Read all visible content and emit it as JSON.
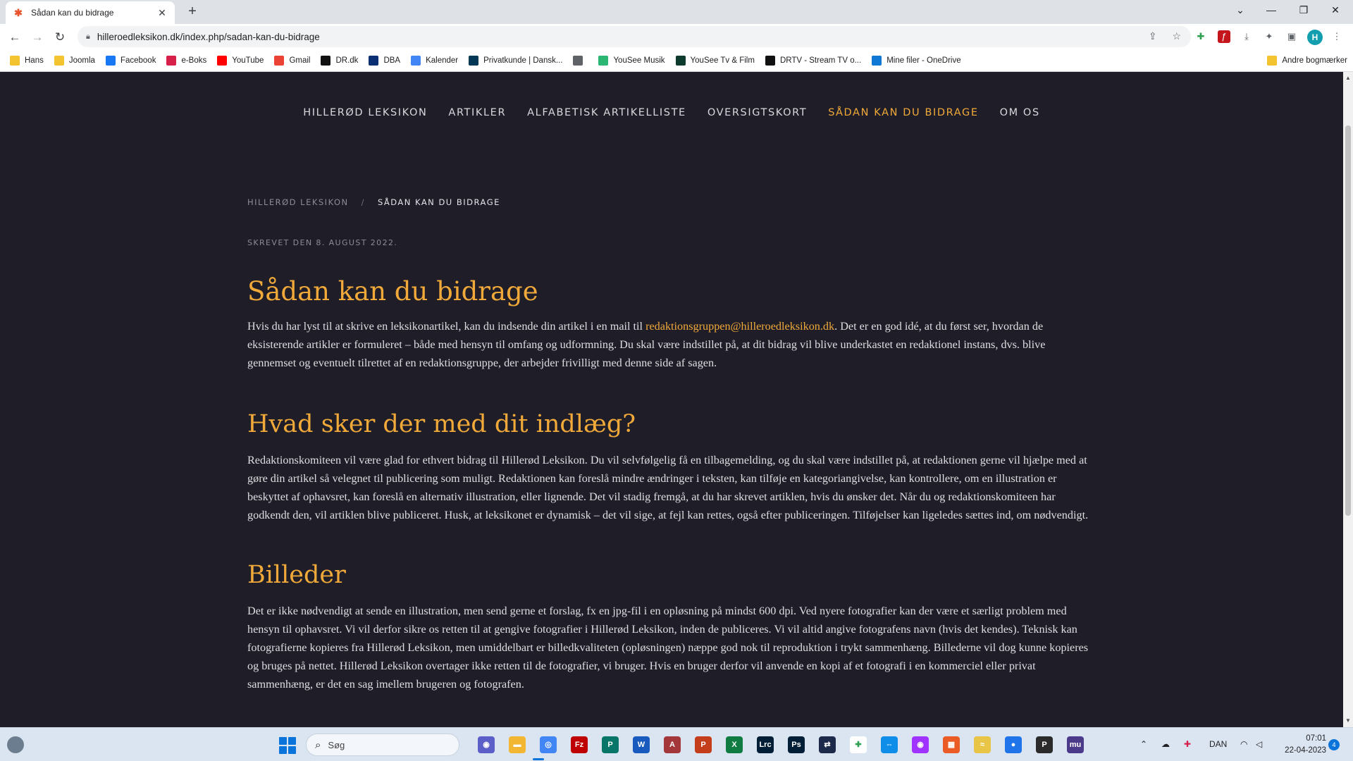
{
  "browser": {
    "tab_title": "Sådan kan du bidrage",
    "url": "hilleroedleksikon.dk/index.php/sadan-kan-du-bidrage",
    "avatar_letter": "H",
    "bookmarks": [
      {
        "label": "Hans",
        "icon": "folder-icon",
        "color": "#f4c430"
      },
      {
        "label": "Joomla",
        "icon": "folder-icon",
        "color": "#f4c430"
      },
      {
        "label": "Facebook",
        "icon": "facebook-icon",
        "color": "#1877f2"
      },
      {
        "label": "e-Boks",
        "icon": "eboks-icon",
        "color": "#d6204a"
      },
      {
        "label": "YouTube",
        "icon": "youtube-icon",
        "color": "#ff0000"
      },
      {
        "label": "Gmail",
        "icon": "gmail-icon",
        "color": "#ea4335"
      },
      {
        "label": "DR.dk",
        "icon": "dr-icon",
        "color": "#111111"
      },
      {
        "label": "DBA",
        "icon": "dba-icon",
        "color": "#0b2f73"
      },
      {
        "label": "Kalender",
        "icon": "calendar-icon",
        "color": "#4285f4"
      },
      {
        "label": "Privatkunde | Dansk...",
        "icon": "bank-icon",
        "color": "#003755"
      },
      {
        "label": "",
        "icon": "globe-icon",
        "color": "#5f6368"
      },
      {
        "label": "YouSee Musik",
        "icon": "music-icon",
        "color": "#2bb673"
      },
      {
        "label": "YouSee Tv & Film",
        "icon": "tv-icon",
        "color": "#0d3b2e"
      },
      {
        "label": "DRTV - Stream TV o...",
        "icon": "drtv-icon",
        "color": "#111111"
      },
      {
        "label": "Mine filer - OneDrive",
        "icon": "onedrive-icon",
        "color": "#0f78d4"
      }
    ],
    "other_bookmarks": "Andre bogmærker"
  },
  "site": {
    "nav": [
      {
        "label": "HILLERØD LEKSIKON",
        "active": false
      },
      {
        "label": "ARTIKLER",
        "active": false
      },
      {
        "label": "ALFABETISK ARTIKELLISTE",
        "active": false
      },
      {
        "label": "OVERSIGTSKORT",
        "active": false
      },
      {
        "label": "SÅDAN KAN DU BIDRAGE",
        "active": true
      },
      {
        "label": "OM OS",
        "active": false
      }
    ],
    "breadcrumb": {
      "home": "HILLERØD LEKSIKON",
      "separator": "/",
      "current": "SÅDAN KAN DU BIDRAGE"
    },
    "meta": "SKREVET DEN 8. AUGUST 2022.",
    "accent_color": "#f1a93a"
  },
  "article": {
    "title": "Sådan kan du bidrage",
    "intro_before_link": "Hvis du har lyst til at skrive en leksikonartikel, kan du indsende din artikel i en mail til ",
    "email": "redaktionsgruppen@hilleroedleksikon.dk",
    "intro_after_link": ".  Det er en god idé, at du først ser, hvordan de eksisterende artikler er formuleret – både med hensyn til omfang og udformning. Du skal være indstillet på, at dit bidrag vil blive underkastet en redaktionel instans, dvs. blive gennemset og eventuelt tilrettet af en redaktionsgruppe, der arbejder frivilligt med denne side af sagen.",
    "section2_title": "Hvad sker der med dit indlæg?",
    "section2_text": "Redaktionskomiteen vil være glad for ethvert bidrag til Hillerød Leksikon. Du vil selvfølgelig få en tilbagemelding, og du skal være indstillet på, at redaktionen gerne vil hjælpe med at gøre din artikel så velegnet til publicering som muligt. Redaktionen kan foreslå mindre ændringer i teksten, kan tilføje en kategoriangivelse, kan kontrollere, om en illustration er beskyttet af ophavsret, kan foreslå en alternativ illustration, eller lignende. Det vil stadig fremgå, at du har skrevet artiklen, hvis du ønsker det. Når du og redaktionskomiteen har godkendt den, vil artiklen blive publiceret. Husk, at leksikonet er dynamisk – det vil sige, at fejl kan rettes, også efter publiceringen. Tilføjelser kan ligeledes sættes ind, om nødvendigt.",
    "section3_title": "Billeder",
    "section3_text": "Det er ikke nødvendigt at sende en illustration, men send gerne et forslag, fx en jpg-fil i en opløsning på mindst 600 dpi. Ved nyere fotografier kan der være et særligt problem med hensyn til ophavsret. Vi vil derfor sikre os retten til at gengive fotografier i Hillerød Leksikon, inden de publiceres. Vi vil altid angive fotografens navn (hvis det kendes). Teknisk kan fotografierne kopieres fra Hillerød Leksikon, men umiddelbart er billedkvaliteten (opløsningen) næppe god nok til reproduktion i trykt sammenhæng. Billederne vil dog kunne kopieres og bruges på nettet. Hillerød Leksikon overtager ikke retten til de fotografier, vi bruger. Hvis en bruger derfor vil anvende en kopi af et fotografi i en kommerciel eller privat sammenhæng, er det en sag imellem brugeren og fotografen."
  },
  "taskbar": {
    "search_placeholder": "Søg",
    "language": "DAN",
    "time": "07:01",
    "date": "22-04-2023",
    "notification_count": "4",
    "apps": [
      {
        "name": "teams-chat",
        "color": "#5b5fc7",
        "glyph": "◉"
      },
      {
        "name": "file-explorer",
        "color": "#f2b632",
        "glyph": "▬"
      },
      {
        "name": "chrome",
        "color": "#4285f4",
        "glyph": "◎"
      },
      {
        "name": "filezilla",
        "color": "#bf0000",
        "glyph": "Fz"
      },
      {
        "name": "publisher",
        "color": "#077568",
        "glyph": "P"
      },
      {
        "name": "word",
        "color": "#185abd",
        "glyph": "W"
      },
      {
        "name": "access",
        "color": "#a4373a",
        "glyph": "A"
      },
      {
        "name": "powerpoint",
        "color": "#c43e1c",
        "glyph": "P"
      },
      {
        "name": "excel",
        "color": "#107c41",
        "glyph": "X"
      },
      {
        "name": "lightroom",
        "color": "#001e36",
        "glyph": "Lrc"
      },
      {
        "name": "photoshop",
        "color": "#001e36",
        "glyph": "Ps"
      },
      {
        "name": "sync-tool",
        "color": "#1e2a4a",
        "glyph": "⇄"
      },
      {
        "name": "app-grid",
        "color": "#ffffff",
        "glyph": "✚"
      },
      {
        "name": "teamviewer",
        "color": "#0e8ee9",
        "glyph": "⇔"
      },
      {
        "name": "messenger",
        "color": "#a033ff",
        "glyph": "◉"
      },
      {
        "name": "office-hub",
        "color": "#eb5b25",
        "glyph": "▦"
      },
      {
        "name": "photo-viewer",
        "color": "#e8c547",
        "glyph": "≈"
      },
      {
        "name": "firefox",
        "color": "#1e74e8",
        "glyph": "●"
      },
      {
        "name": "pro-app",
        "color": "#2b2b2b",
        "glyph": "P"
      },
      {
        "name": "musescore",
        "color": "#4b3a8a",
        "glyph": "mu"
      }
    ]
  }
}
